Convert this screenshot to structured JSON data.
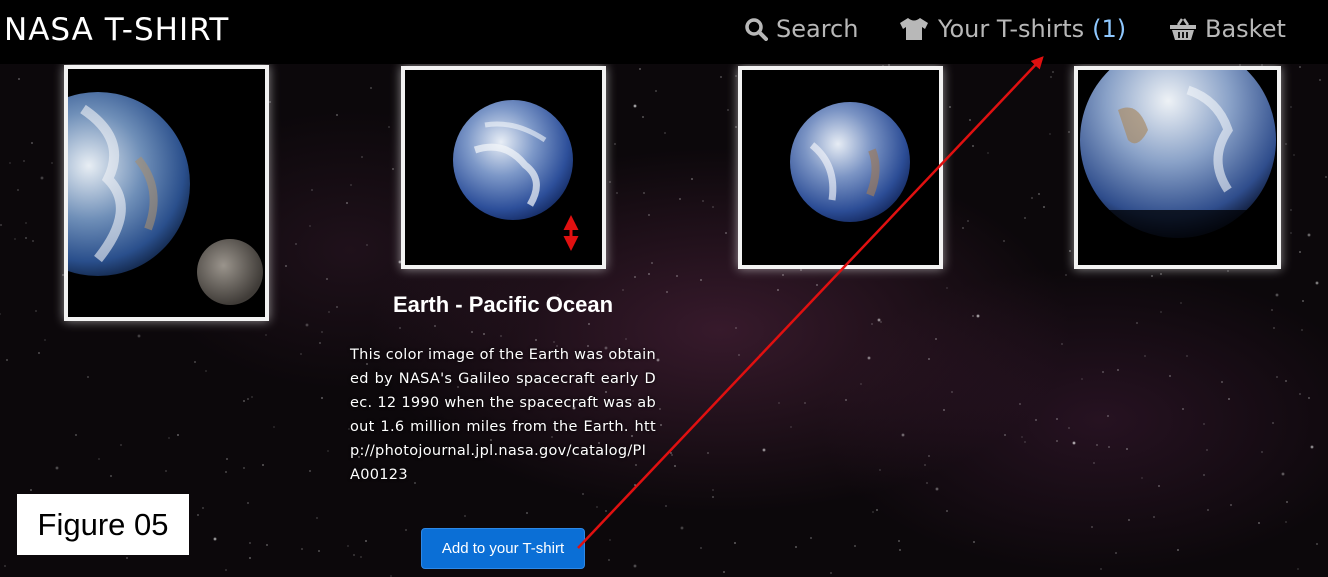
{
  "navbar": {
    "brand": "NASA T-SHIRT",
    "search_label": "Search",
    "tshirts_label": "Your T-shirts",
    "tshirts_count": "(1)",
    "basket_label": "Basket"
  },
  "gallery": {
    "selected": {
      "title": "Earth - Pacific Ocean",
      "description": "This color image of the Earth was obtained by NASA's Galileo spacecraft early Dec. 12 1990 when the spacecraft was about 1.6 million miles from the Earth. http://photojournal.jpl.nasa.gov/catalog/PIA00123",
      "add_button": "Add to your T-shirt"
    }
  },
  "annotation": {
    "figure_label": "Figure 05",
    "arrow_color": "#e01010"
  },
  "colors": {
    "navbar_bg": "#000000",
    "nav_text": "#b8b8b8",
    "count": "#8fc8ff",
    "button": "#0b6fd6"
  }
}
